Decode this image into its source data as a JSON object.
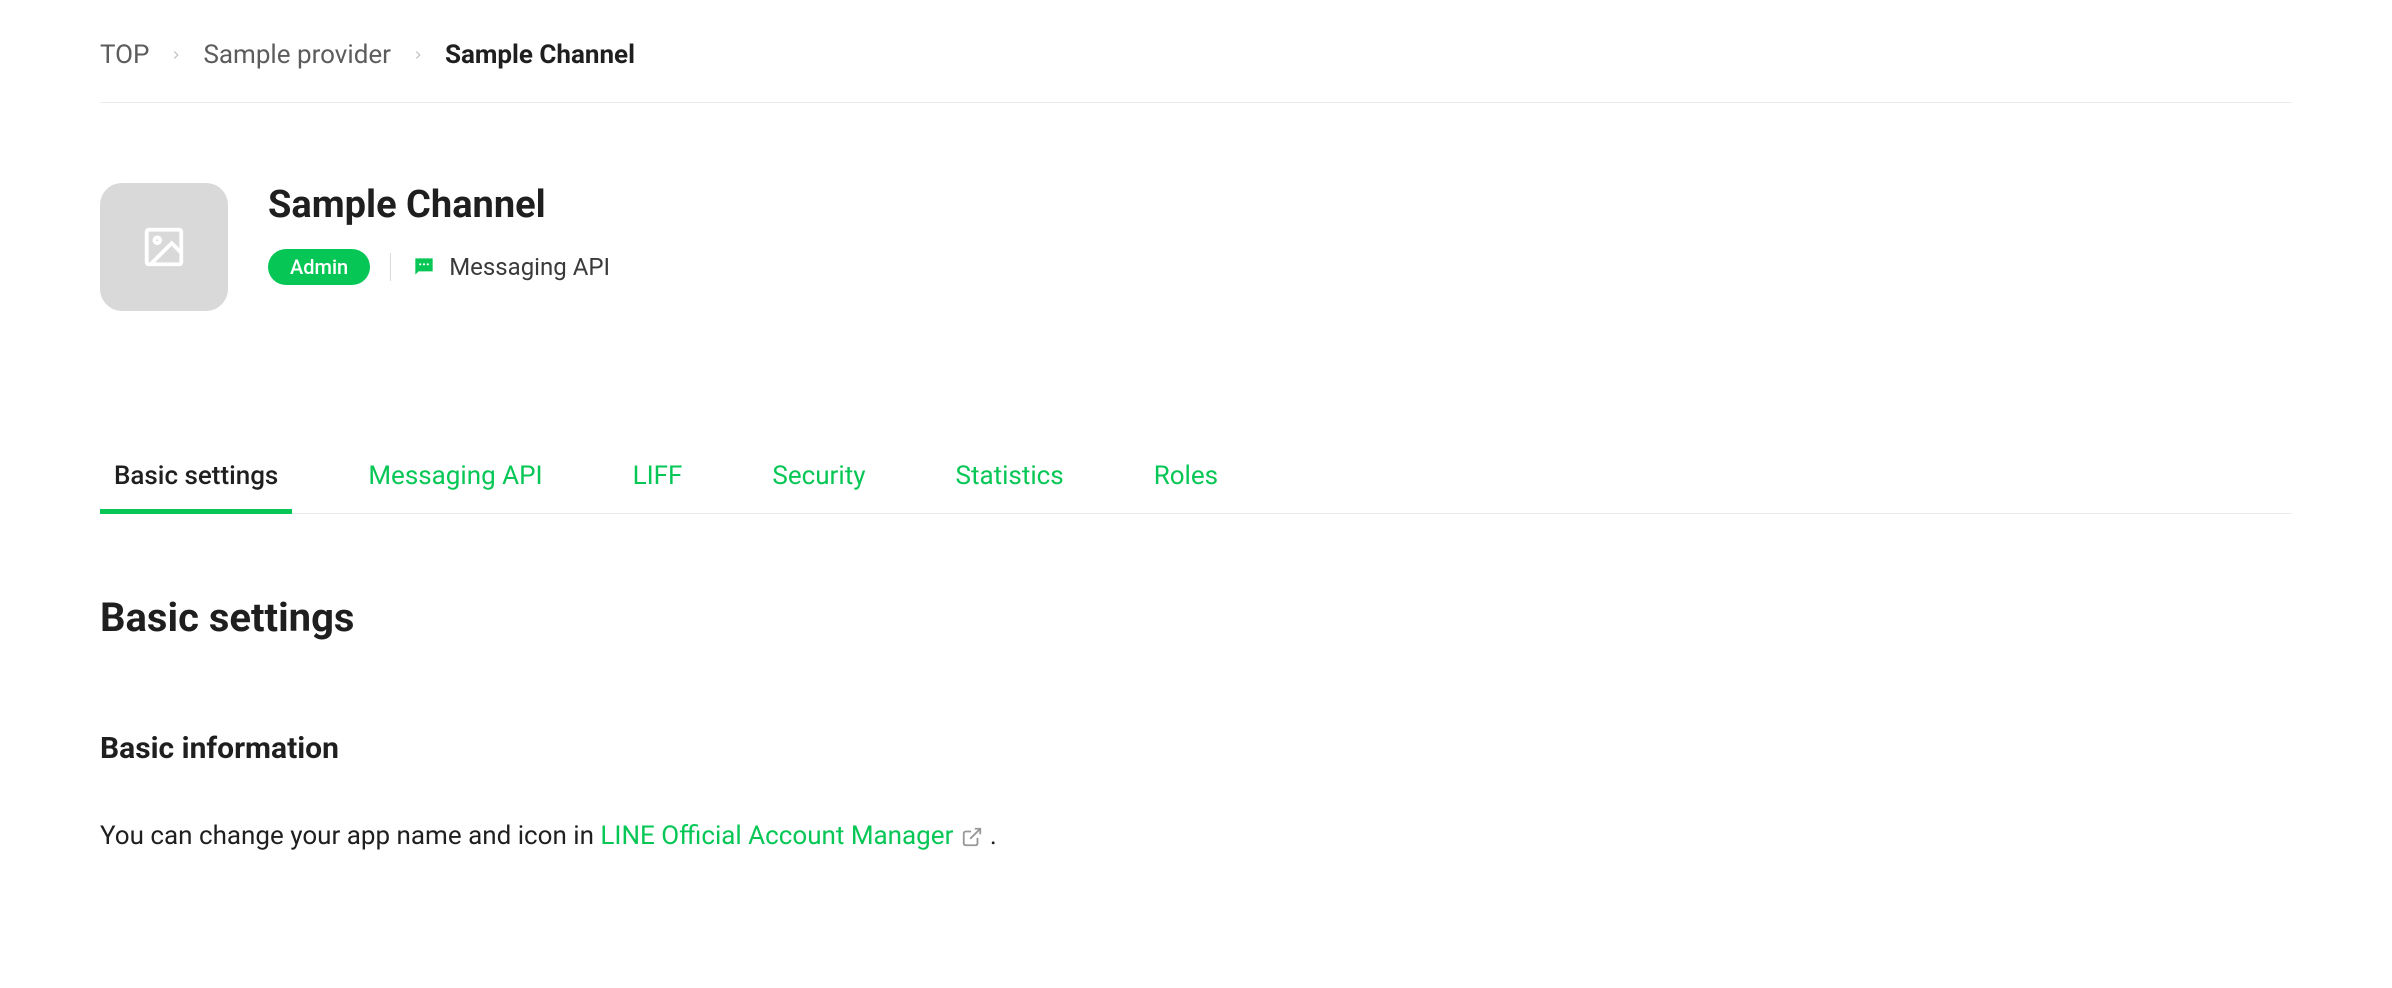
{
  "breadcrumb": {
    "items": [
      {
        "label": "TOP"
      },
      {
        "label": "Sample provider"
      },
      {
        "label": "Sample Channel"
      }
    ]
  },
  "header": {
    "title": "Sample Channel",
    "badge": "Admin",
    "channel_type": "Messaging API"
  },
  "tabs": [
    {
      "label": "Basic settings"
    },
    {
      "label": "Messaging API"
    },
    {
      "label": "LIFF"
    },
    {
      "label": "Security"
    },
    {
      "label": "Statistics"
    },
    {
      "label": "Roles"
    }
  ],
  "content": {
    "section_title": "Basic settings",
    "subsection_title": "Basic information",
    "info_prefix": "You can change your app name and icon in ",
    "info_link": "LINE Official Account Manager",
    "info_suffix": " ."
  }
}
